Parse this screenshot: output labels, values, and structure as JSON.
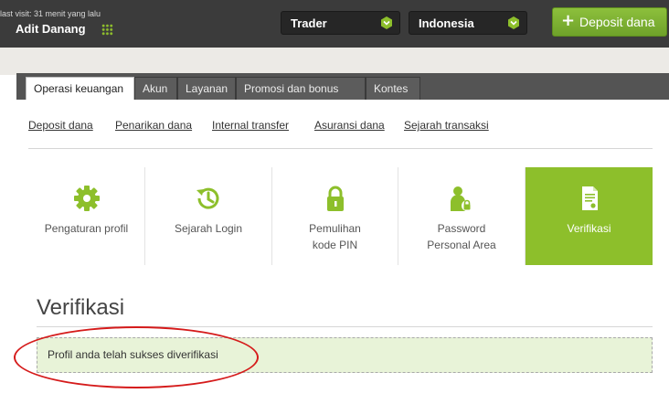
{
  "header": {
    "last_visit": "last visit: 31 menit yang lalu",
    "username": "Adit Danang",
    "account_select": "Trader",
    "country_select": "Indonesia",
    "deposit_button": "Deposit dana",
    "accent_color": "#8dbf2b"
  },
  "tabs": [
    {
      "label": "Operasi keuangan",
      "active": true
    },
    {
      "label": "Akun"
    },
    {
      "label": "Layanan"
    },
    {
      "label": "Promosi dan bonus"
    },
    {
      "label": "Kontes"
    }
  ],
  "subnav": [
    "Deposit dana",
    "Penarikan dana",
    "Internal transfer",
    "Asuransi dana",
    "Sejarah transaksi"
  ],
  "tiles": [
    {
      "label": "Pengaturan profil",
      "icon": "gear-icon"
    },
    {
      "label": "Sejarah Login",
      "icon": "history-icon"
    },
    {
      "label": "Pemulihan kode PIN",
      "icon": "lock-icon"
    },
    {
      "label": "Password Personal Area",
      "icon": "user-lock-icon"
    },
    {
      "label": "Verifikasi",
      "icon": "document-icon",
      "active": true
    }
  ],
  "section": {
    "title": "Verifikasi",
    "notice": "Profil anda telah sukses diverifikasi"
  }
}
